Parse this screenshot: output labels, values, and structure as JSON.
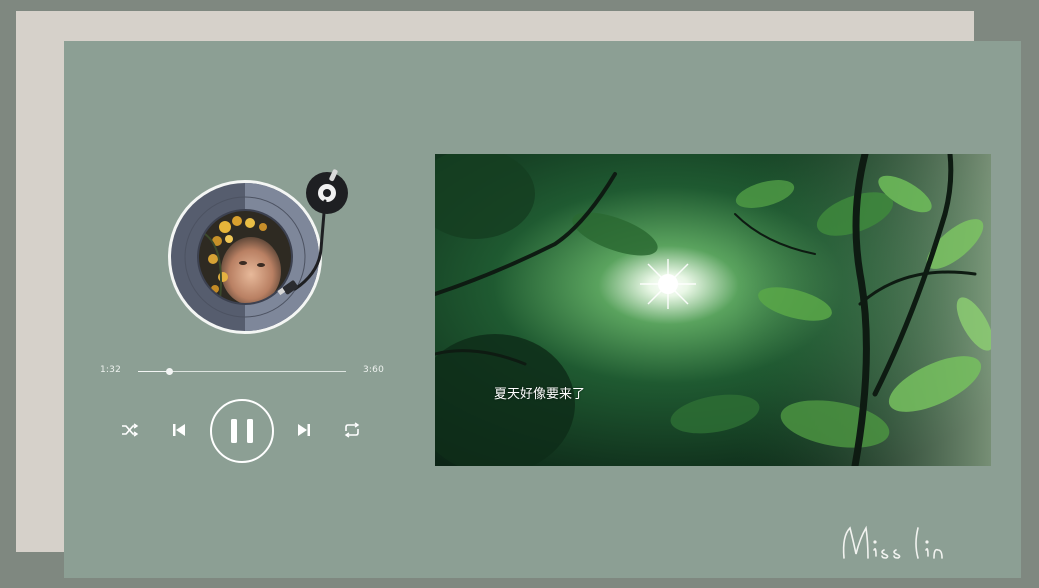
{
  "player": {
    "current_time": "1:32",
    "total_time": "3:60",
    "progress": 0.15,
    "state": "playing"
  },
  "video": {
    "subtitle": "夏天好像要来了"
  },
  "signature": {
    "text": "Miss lin"
  },
  "icons": {
    "shuffle": "shuffle-icon",
    "previous": "skip-previous-icon",
    "pause": "pause-icon",
    "next": "skip-next-icon",
    "repeat": "repeat-icon"
  },
  "colors": {
    "background": "#7f8880",
    "back_card": "#d6d1ca",
    "front_card": "#8c9f94",
    "record": "#5b6373",
    "accent_white": "#ffffff"
  }
}
